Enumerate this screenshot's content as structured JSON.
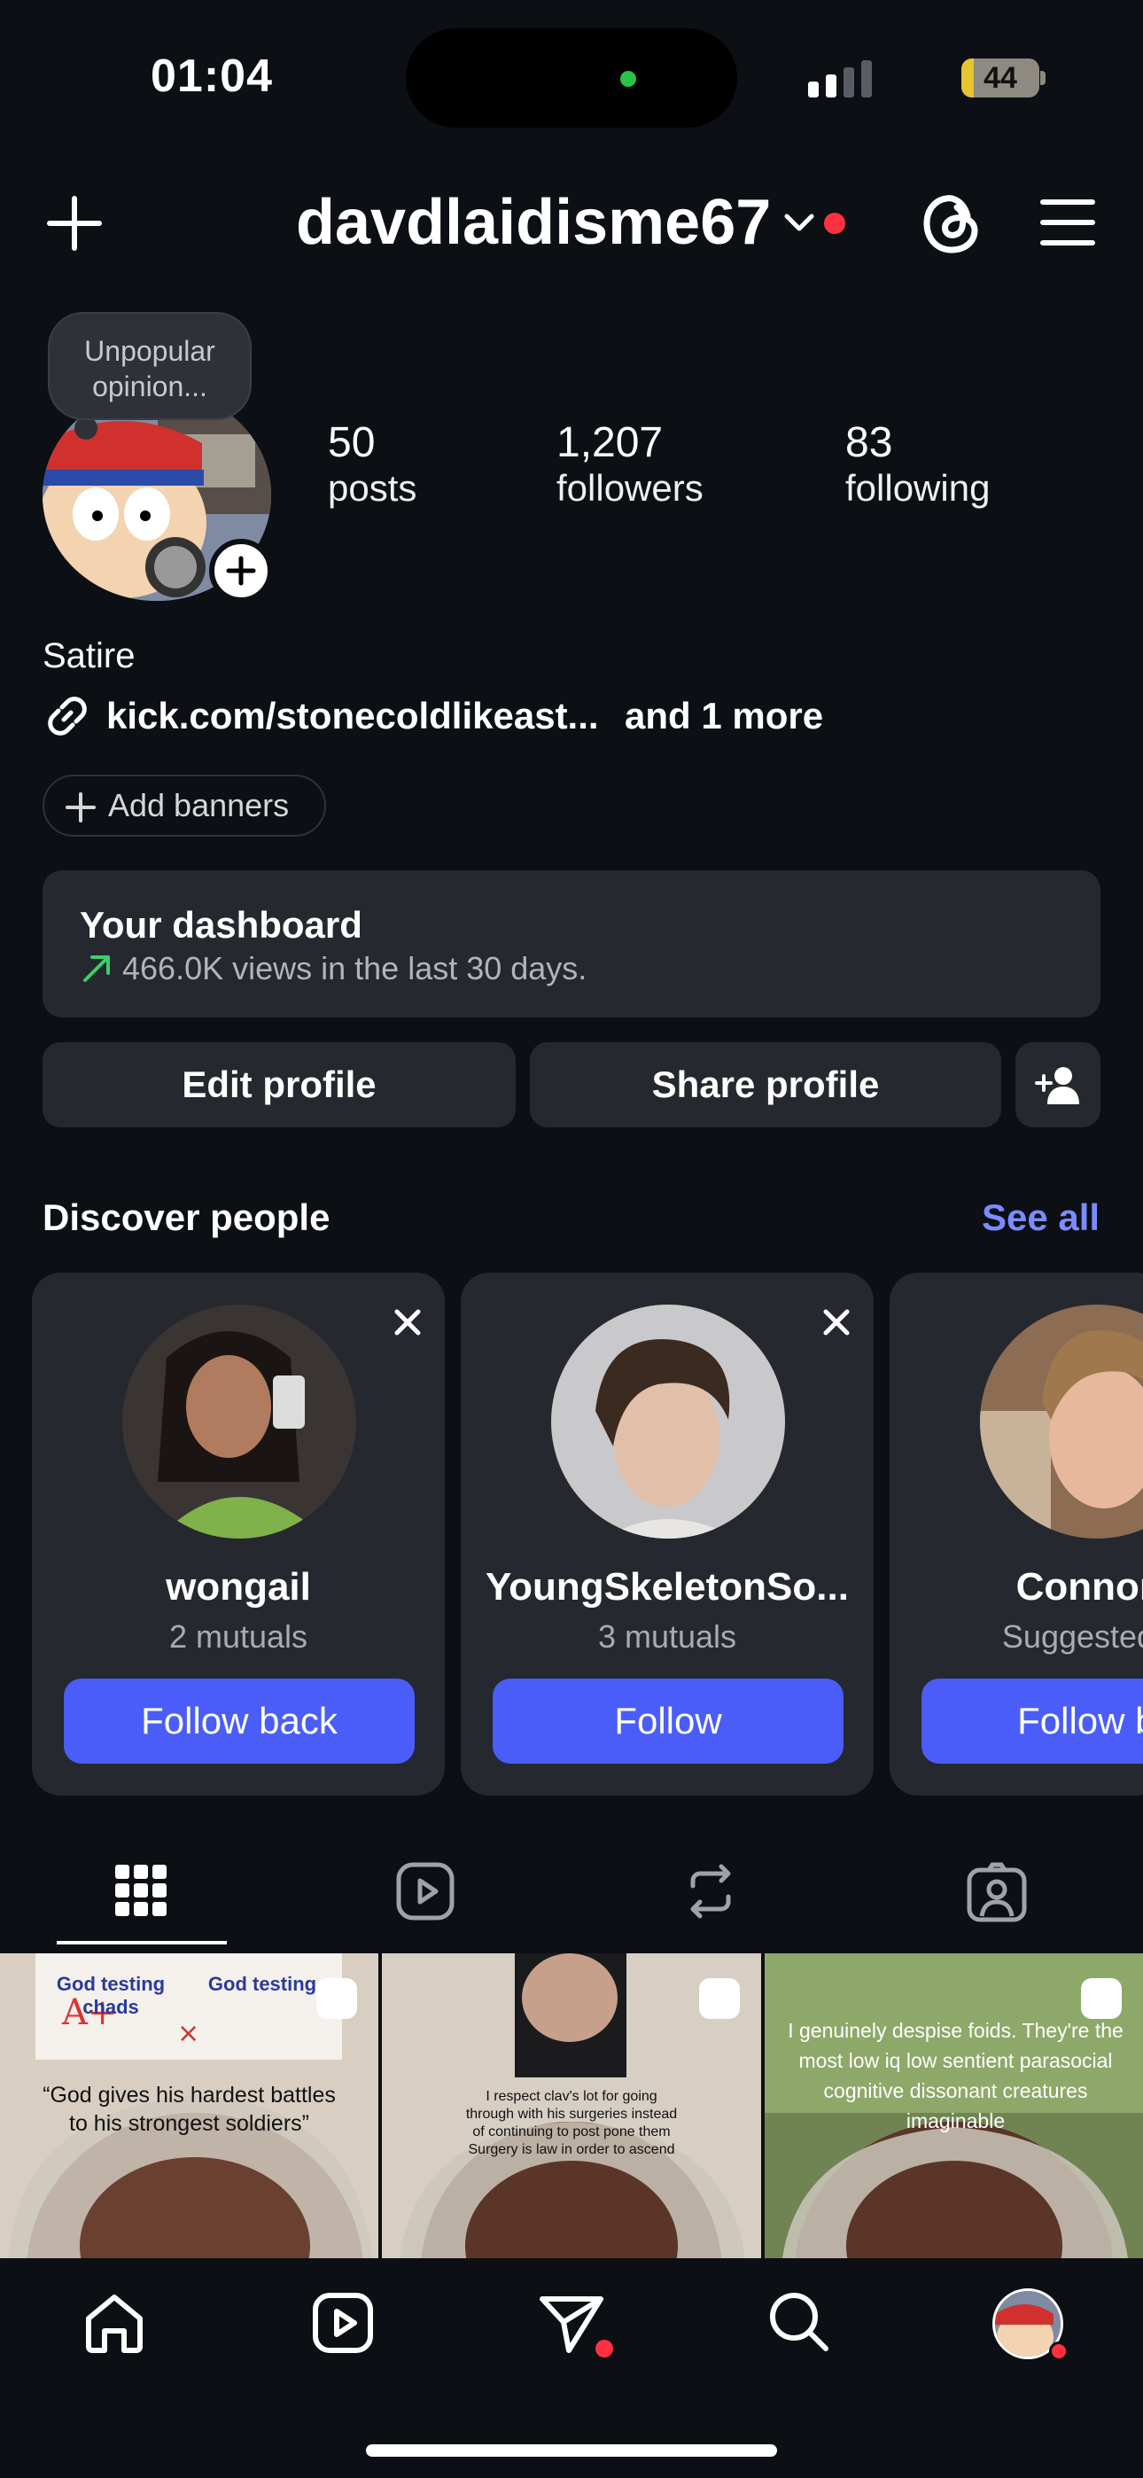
{
  "status_bar": {
    "time": "01:04",
    "battery": "44"
  },
  "header": {
    "username": "davdlaidisme67"
  },
  "profile": {
    "note": "Unpopular opinion...",
    "stats": [
      {
        "value": "50",
        "label": "posts"
      },
      {
        "value": "1,207",
        "label": "followers"
      },
      {
        "value": "83",
        "label": "following"
      }
    ],
    "bio": "Satire",
    "link": "kick.com/stonecoldlikeast...",
    "link_more": "and 1 more",
    "add_banners": "Add banners"
  },
  "dashboard": {
    "title": "Your dashboard",
    "subtitle": "466.0K views in the last 30 days."
  },
  "actions": {
    "edit": "Edit profile",
    "share": "Share profile"
  },
  "discover": {
    "title": "Discover people",
    "see_all": "See all",
    "cards": [
      {
        "name": "wongail",
        "sub": "2 mutuals",
        "button": "Follow back"
      },
      {
        "name": "YoungSkeletonSo...",
        "sub": "3 mutuals",
        "button": "Follow"
      },
      {
        "name": "Connor I",
        "sub": "Suggested fo",
        "button": "Follow ba"
      }
    ]
  },
  "posts": [
    {
      "header_left": "God testing chads",
      "header_right": "God testing",
      "caption": "“God gives his hardest battles to his strongest soldiers”"
    },
    {
      "caption": "I respect clav's lot for going through with his surgeries instead of continuing to post pone them Surgery is law in order to ascend"
    },
    {
      "caption": "I genuinely despise foids. They're the most low iq low sentient parasocial cognitive dissonant creatures imaginable"
    }
  ],
  "colors": {
    "accent": "#4a5df9",
    "link": "#7b8cff",
    "background": "#0c0f14",
    "card": "#25282e",
    "badge": "#ff3040"
  }
}
